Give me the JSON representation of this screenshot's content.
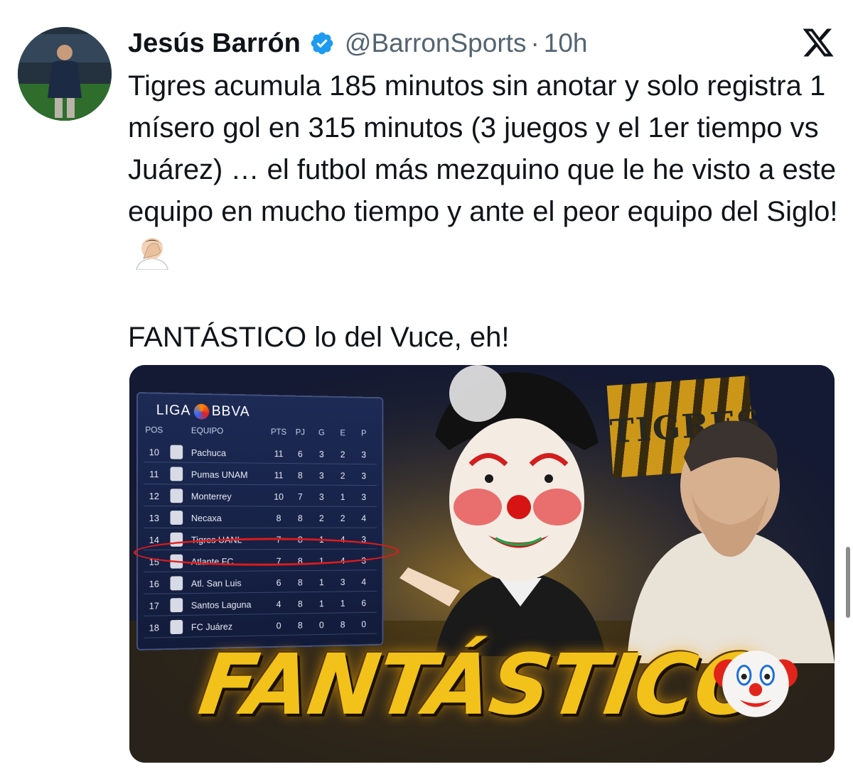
{
  "tweet": {
    "author_name": "Jesús Barrón",
    "handle": "@BarronSports",
    "separator": "·",
    "time": "10h",
    "paragraph_1": "Tigres acumula 185 minutos sin anotar y solo registra 1 mísero gol en 315 minutos (3 juegos y el 1er tiempo vs Juárez) … el futbol más mezquino que le he visto a este equipo en mucho tiempo y ante el peor equipo del Siglo!",
    "paragraph_2": "FANTÁSTICO lo del Vuce, eh!"
  },
  "icons": {
    "verified": "verified-badge-icon",
    "platform": "x-logo-icon",
    "emoji": "face-palm-emoji"
  },
  "colors": {
    "text": "#0f1419",
    "secondary": "#536471",
    "verified": "#1d9bf0"
  },
  "media": {
    "league_brand_left": "LIGA",
    "league_brand_right": "BBVA",
    "headers": [
      "POS",
      "EQUIPO",
      "PTS",
      "PJ",
      "G",
      "E",
      "P"
    ],
    "rows": [
      {
        "pos": "10",
        "team": "Pachuca",
        "pts": "11",
        "pj": "6",
        "g": "3",
        "e": "2",
        "p": "3"
      },
      {
        "pos": "11",
        "team": "Pumas UNAM",
        "pts": "11",
        "pj": "8",
        "g": "3",
        "e": "2",
        "p": "3"
      },
      {
        "pos": "12",
        "team": "Monterrey",
        "pts": "10",
        "pj": "7",
        "g": "3",
        "e": "1",
        "p": "3"
      },
      {
        "pos": "13",
        "team": "Necaxa",
        "pts": "8",
        "pj": "8",
        "g": "2",
        "e": "2",
        "p": "4"
      },
      {
        "pos": "14",
        "team": "Tigres UANL",
        "pts": "7",
        "pj": "8",
        "g": "1",
        "e": "4",
        "p": "3"
      },
      {
        "pos": "15",
        "team": "Atlante FC",
        "pts": "7",
        "pj": "8",
        "g": "1",
        "e": "4",
        "p": "3"
      },
      {
        "pos": "16",
        "team": "Atl. San Luis",
        "pts": "6",
        "pj": "8",
        "g": "1",
        "e": "3",
        "p": "4"
      },
      {
        "pos": "17",
        "team": "Santos Laguna",
        "pts": "4",
        "pj": "8",
        "g": "1",
        "e": "1",
        "p": "6"
      },
      {
        "pos": "18",
        "team": "FC Juárez",
        "pts": "0",
        "pj": "8",
        "g": "0",
        "e": "8",
        "p": "0"
      }
    ],
    "banner_text": "TIGRES",
    "headline": "FANTÁSTICO"
  }
}
